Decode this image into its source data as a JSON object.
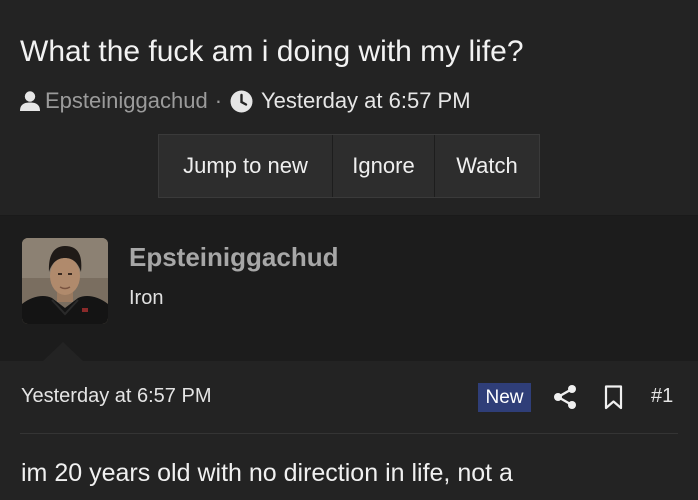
{
  "thread": {
    "title": "What the fuck am i doing with my life?",
    "author": "Epsteiniggachud",
    "separator": "·",
    "date": "Yesterday at 6:57 PM",
    "icons": {
      "author": "user-icon",
      "date": "clock-icon"
    }
  },
  "actions": {
    "jump_to_new": "Jump to new",
    "ignore": "Ignore",
    "watch": "Watch"
  },
  "post": {
    "username": "Epsteiniggachud",
    "user_title": "Iron",
    "date": "Yesterday at 6:57 PM",
    "badge": "New",
    "post_number": "#1",
    "text": "im 20 years old with no direction in life, not a",
    "icons": {
      "share": "share-icon",
      "bookmark": "bookmark-icon",
      "avatar": "avatar"
    }
  },
  "colors": {
    "background": "#232323",
    "user_panel": "#1c1c1c",
    "badge": "#2f3e78",
    "muted_text": "#9b9b9b"
  }
}
